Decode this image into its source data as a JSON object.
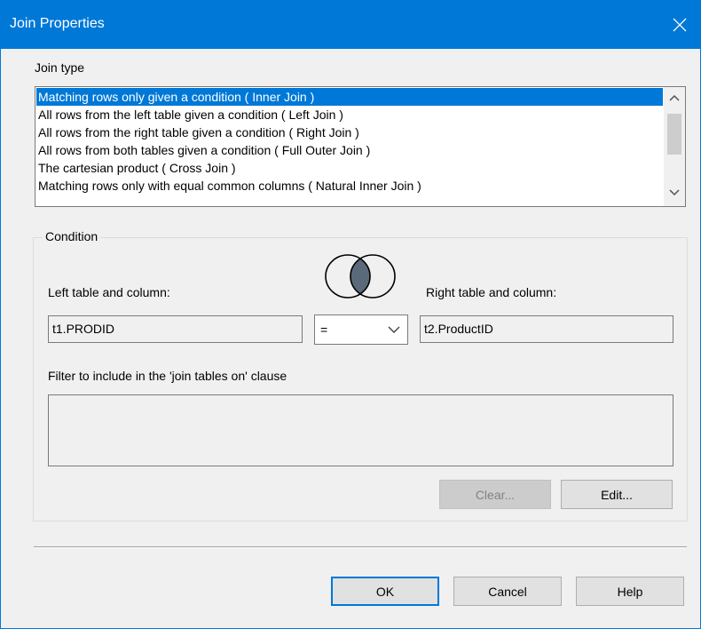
{
  "window": {
    "title": "Join Properties",
    "accent_color": "#0078d7",
    "close_icon": "close-icon"
  },
  "join_type": {
    "label": "Join type",
    "items": [
      "Matching rows only given a condition ( Inner Join )",
      "All rows from the left table given a condition ( Left Join )",
      "All rows from the right table given a condition ( Right Join )",
      "All rows from both tables given a condition ( Full Outer Join )",
      "The cartesian product ( Cross Join )",
      "Matching rows only with equal common columns ( Natural Inner Join )"
    ],
    "selected_index": 0
  },
  "condition": {
    "caption": "Condition",
    "venn_icon": "venn-diagram-inner-join-icon",
    "left_label": "Left table and column:",
    "left_value": "t1.PRODID",
    "operator": "=",
    "right_label": "Right table and column:",
    "right_value": "t2.ProductID",
    "filter_label": "Filter to include in the 'join tables on' clause",
    "filter_value": "",
    "clear_label": "Clear...",
    "edit_label": "Edit..."
  },
  "buttons": {
    "ok_label": "OK",
    "cancel_label": "Cancel",
    "help_label": "Help"
  }
}
